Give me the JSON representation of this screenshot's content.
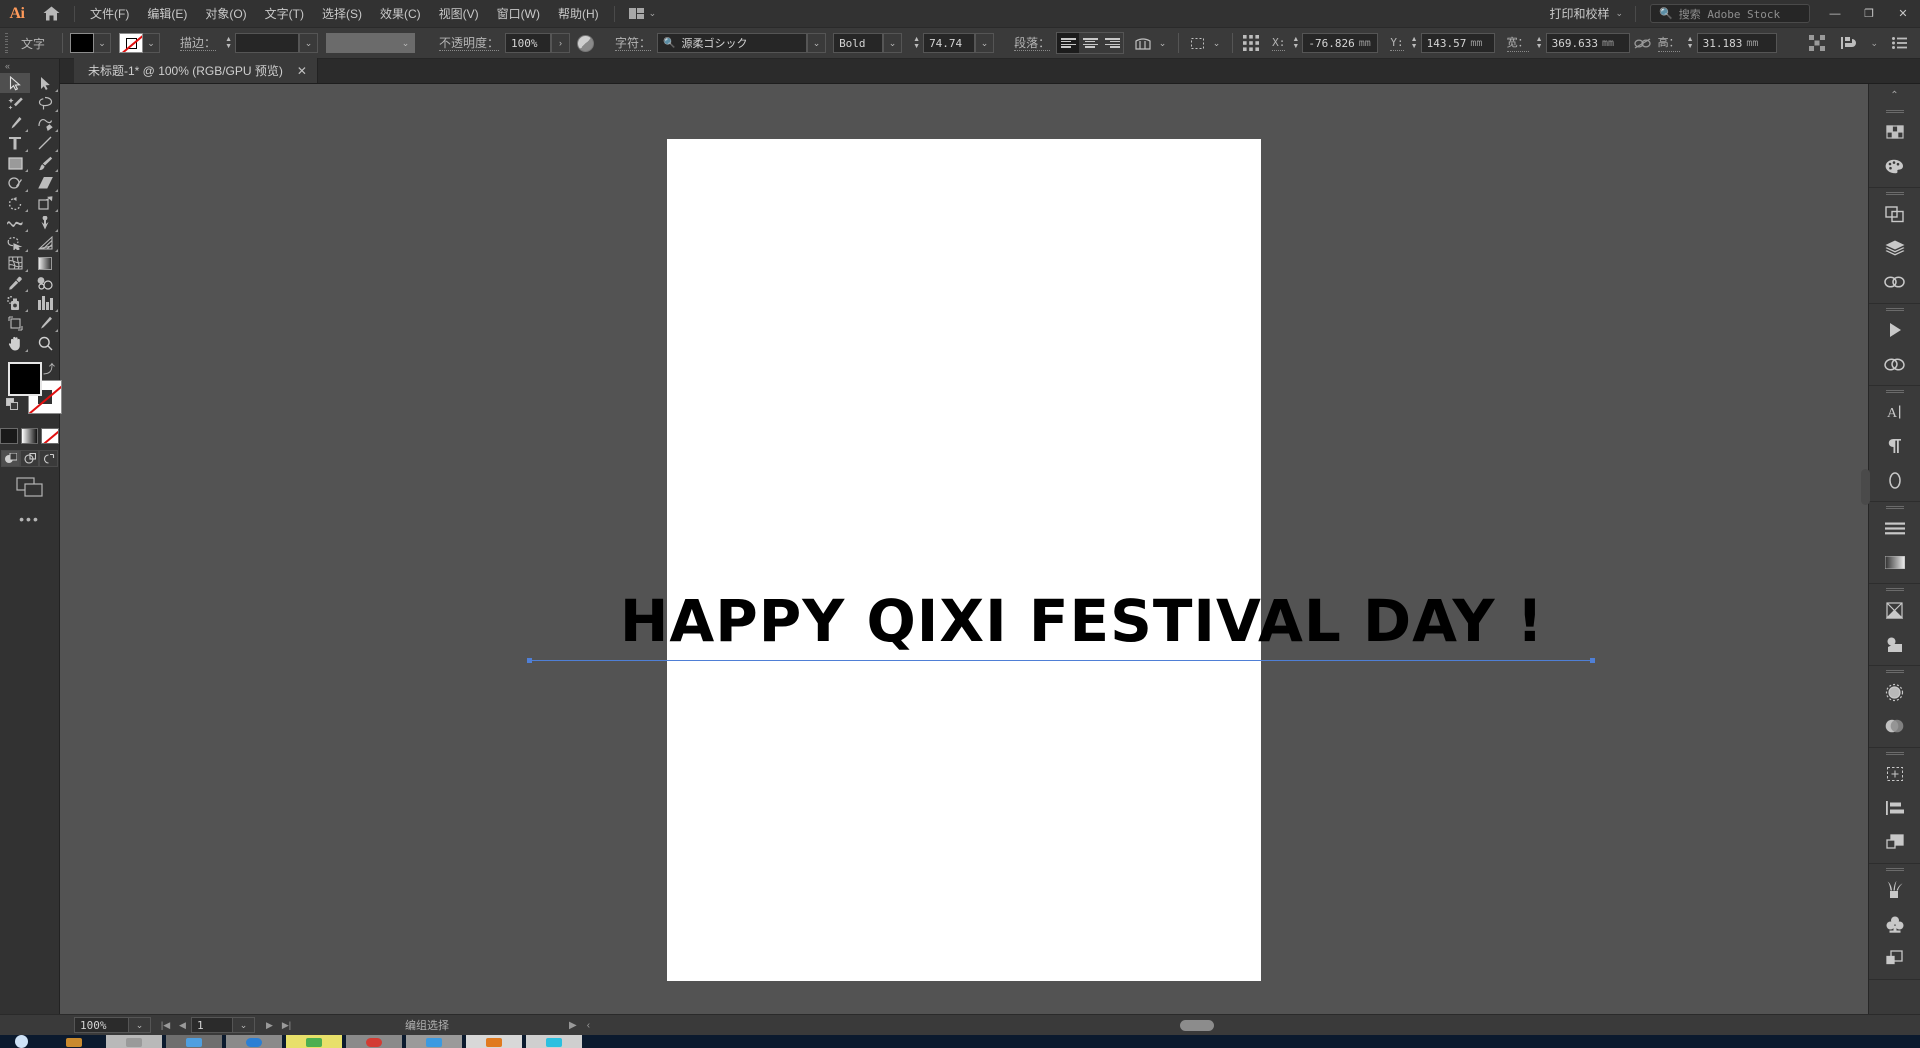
{
  "app": {
    "name": "Adobe Illustrator",
    "logo_text": "Ai"
  },
  "menubar": {
    "items": [
      {
        "label": "文件(F)",
        "name": "menu-file"
      },
      {
        "label": "编辑(E)",
        "name": "menu-edit"
      },
      {
        "label": "对象(O)",
        "name": "menu-object"
      },
      {
        "label": "文字(T)",
        "name": "menu-type"
      },
      {
        "label": "选择(S)",
        "name": "menu-select"
      },
      {
        "label": "效果(C)",
        "name": "menu-effect"
      },
      {
        "label": "视图(V)",
        "name": "menu-view"
      },
      {
        "label": "窗口(W)",
        "name": "menu-window"
      },
      {
        "label": "帮助(H)",
        "name": "menu-help"
      }
    ],
    "workspace": "打印和校样",
    "stock_search_placeholder": "搜索 Adobe Stock",
    "window_buttons": {
      "minimize": "—",
      "restore": "❐",
      "close": "✕"
    }
  },
  "controlbar": {
    "mode_label": "文字",
    "fill_color": "#000000",
    "stroke_label": "描边：",
    "stroke_weight": "",
    "stroke_profile": "",
    "opacity_label": "不透明度：",
    "opacity_value": "100%",
    "char_label": "字符：",
    "font_family": "源柔ゴシック",
    "font_style": "Bold",
    "font_size": "74.74",
    "paragraph_label": "段落：",
    "x_label": "X:",
    "x_value": "-76.826",
    "x_unit": "mm",
    "y_label": "Y:",
    "y_value": "143.57",
    "y_unit": "mm",
    "w_label": "宽：",
    "w_value": "369.633",
    "w_unit": "mm",
    "h_label": "高：",
    "h_value": "31.183",
    "h_unit": "mm"
  },
  "tabs": [
    {
      "title": "未标题-1* @ 100% (RGB/GPU 预览)",
      "close": "✕",
      "active": true
    }
  ],
  "left_toolbar": {
    "tools": [
      {
        "name": "selection-tool",
        "selected": true
      },
      {
        "name": "direct-selection-tool",
        "selected": false
      },
      {
        "name": "magic-wand-tool",
        "selected": false
      },
      {
        "name": "lasso-tool",
        "selected": false
      },
      {
        "name": "pen-tool",
        "selected": false
      },
      {
        "name": "curvature-tool",
        "selected": false
      },
      {
        "name": "type-tool",
        "selected": false
      },
      {
        "name": "line-segment-tool",
        "selected": false
      },
      {
        "name": "rectangle-tool",
        "selected": false
      },
      {
        "name": "paintbrush-tool",
        "selected": false
      },
      {
        "name": "shaper-tool",
        "selected": false
      },
      {
        "name": "eraser-tool",
        "selected": false
      },
      {
        "name": "rotate-tool",
        "selected": false
      },
      {
        "name": "scale-tool",
        "selected": false
      },
      {
        "name": "width-tool",
        "selected": false
      },
      {
        "name": "free-transform-tool",
        "selected": false
      },
      {
        "name": "shape-builder-tool",
        "selected": false
      },
      {
        "name": "perspective-grid-tool",
        "selected": false
      },
      {
        "name": "mesh-tool",
        "selected": false
      },
      {
        "name": "gradient-tool",
        "selected": false
      },
      {
        "name": "eyedropper-tool",
        "selected": false
      },
      {
        "name": "blend-tool",
        "selected": false
      },
      {
        "name": "symbol-sprayer-tool",
        "selected": false
      },
      {
        "name": "column-graph-tool",
        "selected": false
      },
      {
        "name": "artboard-tool",
        "selected": false
      },
      {
        "name": "slice-tool",
        "selected": false
      },
      {
        "name": "hand-tool",
        "selected": false
      },
      {
        "name": "zoom-tool",
        "selected": false
      }
    ],
    "fill_color": "#000000",
    "stroke_color": "none",
    "more_tools": "•••"
  },
  "right_panel": {
    "icons": [
      {
        "name": "color-panel-icon"
      },
      {
        "name": "color-guide-panel-icon"
      },
      {
        "name": "pathfinder-panel-icon"
      },
      {
        "name": "layers-panel-icon"
      },
      {
        "name": "links-panel-icon"
      },
      {
        "name": "actions-panel-icon"
      },
      {
        "name": "symbols-panel-icon"
      },
      {
        "name": "character-panel-icon"
      },
      {
        "name": "paragraph-panel-icon"
      },
      {
        "name": "glyphs-panel-icon"
      },
      {
        "name": "stroke-panel-icon"
      },
      {
        "name": "gradient-panel-icon"
      },
      {
        "name": "separations-preview-panel-icon"
      },
      {
        "name": "transparency-panel-icon"
      },
      {
        "name": "appearance-panel-icon"
      },
      {
        "name": "graphic-styles-panel-icon"
      },
      {
        "name": "transform-panel-icon"
      },
      {
        "name": "align-panel-icon"
      },
      {
        "name": "artboards-panel-icon"
      },
      {
        "name": "brushes-panel-icon"
      },
      {
        "name": "swatches-panel-icon"
      },
      {
        "name": "asset-export-panel-icon"
      }
    ]
  },
  "canvas": {
    "artwork_text": "HAPPY QIXI FESTIVAL DAY !",
    "artboard_background": "#ffffff",
    "canvas_background": "#535353",
    "selection_color": "#4f7fd6"
  },
  "statusbar": {
    "zoom": "100%",
    "page": "1",
    "status_text": "编组选择",
    "nav_first": "|◀",
    "nav_prev": "◀",
    "nav_next": "▶",
    "nav_last": "▶|"
  }
}
